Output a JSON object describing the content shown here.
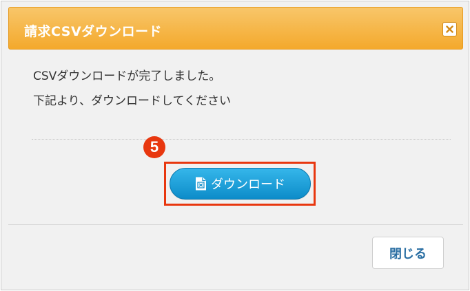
{
  "dialog": {
    "title": "請求CSVダウンロード",
    "close_icon": "close-x-icon",
    "message_line1": "CSVダウンロードが完了しました。",
    "message_line2": "下記より、ダウンロードしてください",
    "step_number": "5",
    "download_button_label": "ダウンロード",
    "download_icon": "spreadsheet-file-icon",
    "close_button_label": "閉じる"
  },
  "colors": {
    "titlebar": "#f4a92c",
    "download_button": "#0d8cc9",
    "annotation": "#e8370f",
    "close_label": "#2b6fa3"
  }
}
